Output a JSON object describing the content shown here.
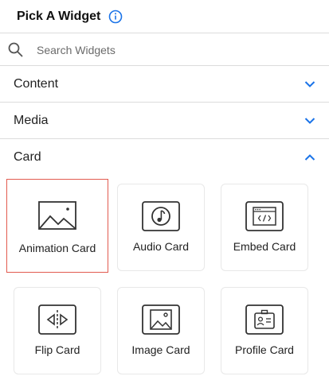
{
  "header": {
    "title": "Pick A Widget"
  },
  "search": {
    "placeholder": "Search Widgets"
  },
  "sections": {
    "content": "Content",
    "media": "Media",
    "card": "Card"
  },
  "cards": {
    "animation": "Animation Card",
    "audio": "Audio Card",
    "embed": "Embed Card",
    "flip": "Flip Card",
    "image": "Image Card",
    "profile": "Profile Card"
  },
  "colors": {
    "accent": "#1a73e8",
    "selected_border": "#e25b4f",
    "icon_stroke": "#333333"
  }
}
